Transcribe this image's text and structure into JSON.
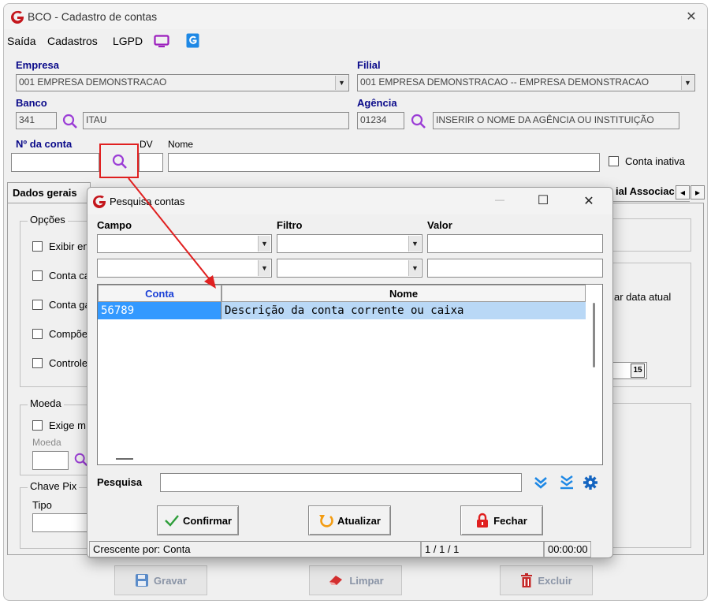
{
  "window": {
    "title": "BCO - Cadastro de contas",
    "close_glyph": "✕",
    "accent": "#c4161c"
  },
  "menu": {
    "items": [
      "Saída",
      "Cadastros",
      "LGPD"
    ]
  },
  "form": {
    "empresa_label": "Empresa",
    "empresa_value": "001 EMPRESA DEMONSTRACAO",
    "filial_label": "Filial",
    "filial_value": "001 EMPRESA DEMONSTRACAO -- EMPRESA DEMONSTRACAO",
    "banco_label": "Banco",
    "banco_code": "341",
    "banco_name": "ITAU",
    "agencia_label": "Agência",
    "agencia_code": "01234",
    "agencia_name": "INSERIR O NOME DA AGÊNCIA OU INSTITUIÇÃO",
    "conta_label": "Nº da conta",
    "conta_value": "",
    "dv_label": "DV",
    "dv_value": "",
    "nome_label": "Nome",
    "nome_value": "",
    "inativa_label": "Conta inativa"
  },
  "tabs": {
    "first": "Dados gerais",
    "last": "ial Associac",
    "left_arrow": "◂",
    "right_arrow": "▸"
  },
  "opcoes": {
    "title": "Opções",
    "items": [
      "Exibir en",
      "Conta ca",
      "Conta ga",
      "Compõe",
      "Controle"
    ]
  },
  "right_panel": {
    "text": "ar data atual",
    "calendar_label": "15"
  },
  "moeda": {
    "title": "Moeda",
    "exige": "Exige m",
    "field_label": "Moeda",
    "value": ""
  },
  "pix": {
    "title": "Chave Pix",
    "tipo_label": "Tipo",
    "tipo_value": ""
  },
  "footer_buttons": {
    "gravar": "Gravar",
    "limpar": "Limpar",
    "excluir": "Excluir"
  },
  "dialog": {
    "title": "Pesquisa contas",
    "minimize": "—",
    "maximize": "☐",
    "close": "✕",
    "campo_label": "Campo",
    "filtro_label": "Filtro",
    "valor_label": "Valor",
    "filter_rows": [
      {
        "campo": "",
        "filtro": "",
        "valor": ""
      },
      {
        "campo": "",
        "filtro": "",
        "valor": ""
      }
    ],
    "grid": {
      "headers": [
        "Conta",
        "Nome"
      ],
      "rows": [
        {
          "conta": "56789",
          "nome": "Descrição da conta corrente ou caixa"
        }
      ]
    },
    "pesquisa_label": "Pesquisa",
    "pesquisa_value": "",
    "confirmar": "Confirmar",
    "atualizar": "Atualizar",
    "fechar": "Fechar",
    "status": {
      "ordem": "Crescente por: Conta",
      "pagina": "1 / 1 / 1",
      "tempo": "00:00:00"
    }
  },
  "colors": {
    "label_blue": "#0a0a8a",
    "selection_blue": "#3399ff",
    "highlight_red": "#e02020",
    "icon_purple": "#9b3dd6",
    "icon_blue": "#1e88e5"
  }
}
